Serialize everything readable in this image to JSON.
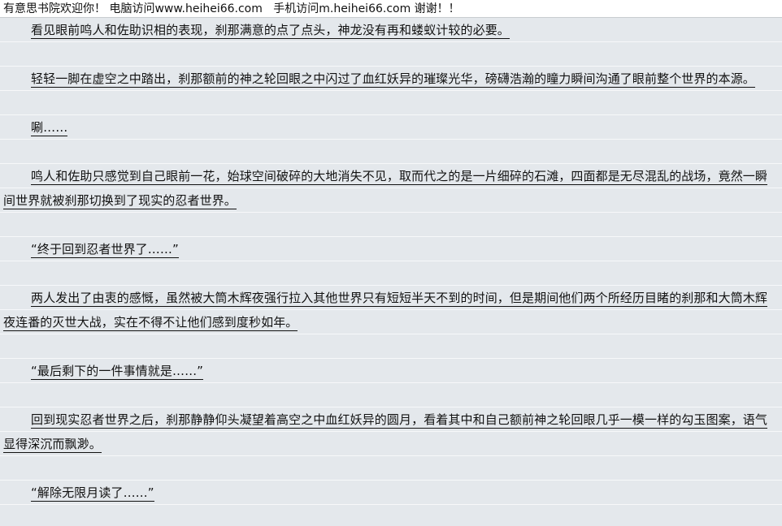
{
  "banner": {
    "text": "有意思书院欢迎你！ 电脑访问www.heihei66.com   手机访问m.heihei66.com 谢谢！！"
  },
  "paragraphs": [
    "看见眼前鸣人和佐助识相的表现，刹那满意的点了点头，神龙没有再和蝼蚁计较的必要。",
    "轻轻一脚在虚空之中踏出，刹那额前的神之轮回眼之中闪过了血红妖异的璀璨光华，磅礴浩瀚的瞳力瞬间沟通了眼前整个世界的本源。",
    "唰……",
    "鸣人和佐助只感觉到自己眼前一花，始球空间破碎的大地消失不见，取而代之的是一片细碎的石滩，四面都是无尽混乱的战场，竟然一瞬间世界就被刹那切换到了现实的忍者世界。",
    "“终于回到忍者世界了……”",
    "两人发出了由衷的感慨，虽然被大筒木辉夜强行拉入其他世界只有短短半天不到的时间，但是期间他们两个所经历目睹的刹那和大筒木辉夜连番的灭世大战，实在不得不让他们感到度秒如年。",
    "“最后剩下的一件事情就是……”",
    "回到现实忍者世界之后，刹那静静仰头凝望着高空之中血红妖异的圆月，看着其中和自己额前神之轮回眼几乎一模一样的勾玉图案，语气显得深沉而飘渺。",
    "“解除无限月读了……”"
  ]
}
